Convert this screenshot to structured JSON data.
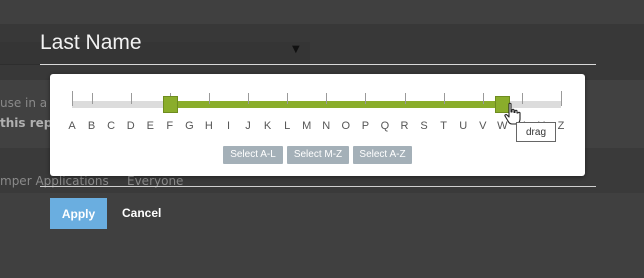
{
  "dialog": {
    "title": "Last Name"
  },
  "background": {
    "line1": "use in a v",
    "line2": "this repo",
    "row_app": "mper Applications",
    "row_value": "Everyone"
  },
  "slider": {
    "letters": [
      "A",
      "B",
      "C",
      "D",
      "E",
      "F",
      "G",
      "H",
      "I",
      "J",
      "K",
      "L",
      "M",
      "N",
      "O",
      "P",
      "Q",
      "R",
      "S",
      "T",
      "U",
      "V",
      "W",
      "X",
      "Y",
      "Z"
    ],
    "range_start": "F",
    "range_end": "W",
    "fill_color": "#8aad2b",
    "track_color": "#dcdcdc"
  },
  "presets": [
    {
      "label": "Select A-L"
    },
    {
      "label": "Select M-Z"
    },
    {
      "label": "Select A-Z"
    }
  ],
  "tooltip": {
    "text": "drag"
  },
  "cursor": {
    "icon": "hand-pointer-icon"
  },
  "actions": {
    "apply_label": "Apply",
    "cancel_label": "Cancel",
    "apply_color": "#6aaee0"
  }
}
